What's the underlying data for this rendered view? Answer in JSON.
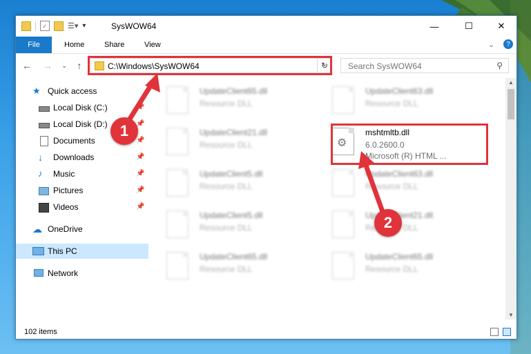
{
  "window": {
    "title": "SysWOW64",
    "controls": {
      "minimize": "—",
      "maximize": "☐",
      "close": "✕"
    }
  },
  "ribbon": {
    "file_label": "File",
    "tabs": [
      "Home",
      "Share",
      "View"
    ],
    "collapse_icon": "chevron-down-icon",
    "help_icon": "help-icon"
  },
  "navigation": {
    "address_path": "C:\\Windows\\SysWOW64",
    "search_placeholder": "Search SysWOW64"
  },
  "sidebar": {
    "items": [
      {
        "label": "Quick access",
        "icon": "star-icon"
      },
      {
        "label": "Local Disk (C:)",
        "icon": "drive-icon",
        "pinned": true
      },
      {
        "label": "Local Disk (D:)",
        "icon": "drive-icon",
        "pinned": true
      },
      {
        "label": "Documents",
        "icon": "documents-icon",
        "pinned": true
      },
      {
        "label": "Downloads",
        "icon": "download-icon",
        "pinned": true
      },
      {
        "label": "Music",
        "icon": "music-icon",
        "pinned": true
      },
      {
        "label": "Pictures",
        "icon": "pictures-icon",
        "pinned": true
      },
      {
        "label": "Videos",
        "icon": "videos-icon",
        "pinned": true
      },
      {
        "label": "OneDrive",
        "icon": "cloud-icon"
      },
      {
        "label": "This PC",
        "icon": "computer-icon",
        "selected": true
      },
      {
        "label": "Network",
        "icon": "network-icon"
      }
    ]
  },
  "files": {
    "left": [
      {
        "name": "UpdateClient65.dll",
        "detail": "Resource DLL"
      },
      {
        "name": "UpdateClient21.dll",
        "detail": "Resource DLL"
      },
      {
        "name": "UpdateClient5.dll",
        "detail": "Resource DLL"
      },
      {
        "name": "UpdateClient5.dll",
        "detail": "Resource DLL"
      },
      {
        "name": "UpdateClient65.dll",
        "detail": "Resource DLL"
      }
    ],
    "right": [
      {
        "name": "UpdateClient63.dll",
        "detail": "Resource DLL"
      },
      {
        "name": "mshtmltb.dll",
        "version": "6.0.2600.0",
        "detail": "Microsoft (R) HTML ...",
        "highlighted": true
      },
      {
        "name": "UpdateClient63.dll",
        "detail": "Resource DLL"
      },
      {
        "name": "UpdateClient21.dll",
        "detail": "Resource DLL"
      },
      {
        "name": "UpdateClient65.dll",
        "detail": "Resource DLL"
      }
    ]
  },
  "status": {
    "item_count": "102 items"
  },
  "annotations": {
    "step1": "1",
    "step2": "2",
    "color": "#e0333a"
  },
  "colors": {
    "accent": "#1979ca",
    "selection": "#cce8ff",
    "highlight": "#e0333a"
  }
}
